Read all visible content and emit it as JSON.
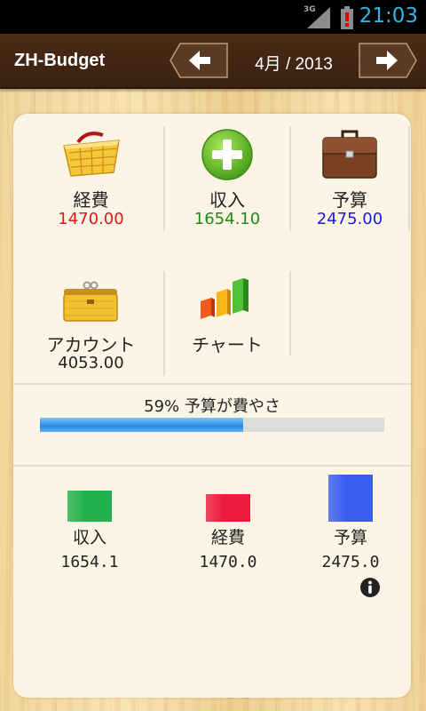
{
  "status": {
    "network": "3G",
    "time": "21:03"
  },
  "header": {
    "app_title": "ZH-Budget",
    "month": "4月 / 2013",
    "prev_icon": "arrow-left-icon",
    "next_icon": "arrow-right-icon"
  },
  "tiles": {
    "expense": {
      "label": "経費",
      "value": "1470.00",
      "icon": "basket-icon",
      "color": "#e8141a"
    },
    "income": {
      "label": "収入",
      "value": "1654.10",
      "icon": "plus-circle-icon",
      "color": "#1b8a1b"
    },
    "budget": {
      "label": "予算",
      "value": "2475.00",
      "icon": "briefcase-icon",
      "color": "#1a1ae6"
    },
    "account": {
      "label": "アカウント",
      "value": "4053.00",
      "icon": "wallet-icon"
    },
    "chart": {
      "label": "チャート",
      "icon": "bar-chart-icon"
    }
  },
  "progress": {
    "text": "59% 予算が費やさ",
    "fraction": 0.59
  },
  "summary": {
    "items": [
      {
        "label": "収入",
        "value": "1654.1",
        "color": "#22b14c"
      },
      {
        "label": "経費",
        "value": "1470.0",
        "color": "#ed1c3c"
      },
      {
        "label": "予算",
        "value": "2475.0",
        "color": "#3a5cf0"
      }
    ],
    "info_icon": "info-icon"
  }
}
